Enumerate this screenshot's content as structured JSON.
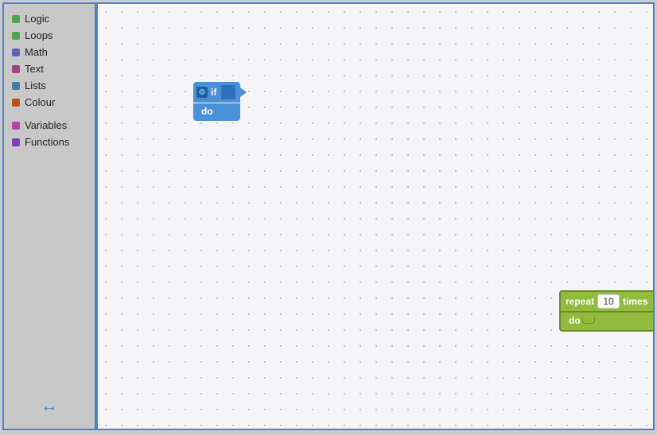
{
  "sidebar": {
    "items": [
      {
        "id": "logic",
        "label": "Logic",
        "color": "#4fa84f"
      },
      {
        "id": "loops",
        "label": "Loops",
        "color": "#4fa84f"
      },
      {
        "id": "math",
        "label": "Math",
        "color": "#6060c0"
      },
      {
        "id": "text",
        "label": "Text",
        "color": "#a04080"
      },
      {
        "id": "lists",
        "label": "Lists",
        "color": "#4080a0"
      },
      {
        "id": "colour",
        "label": "Colour",
        "color": "#c05020"
      }
    ],
    "items2": [
      {
        "id": "variables",
        "label": "Variables",
        "color": "#c040a0"
      },
      {
        "id": "functions",
        "label": "Functions",
        "color": "#8040c0"
      }
    ],
    "resize_icon": "↔"
  },
  "blocks": {
    "if_block": {
      "if_label": "if",
      "do_label": "do"
    },
    "repeat_block": {
      "repeat_label": "repeat",
      "times_label": "times",
      "value": "10",
      "do_label": "do"
    }
  }
}
